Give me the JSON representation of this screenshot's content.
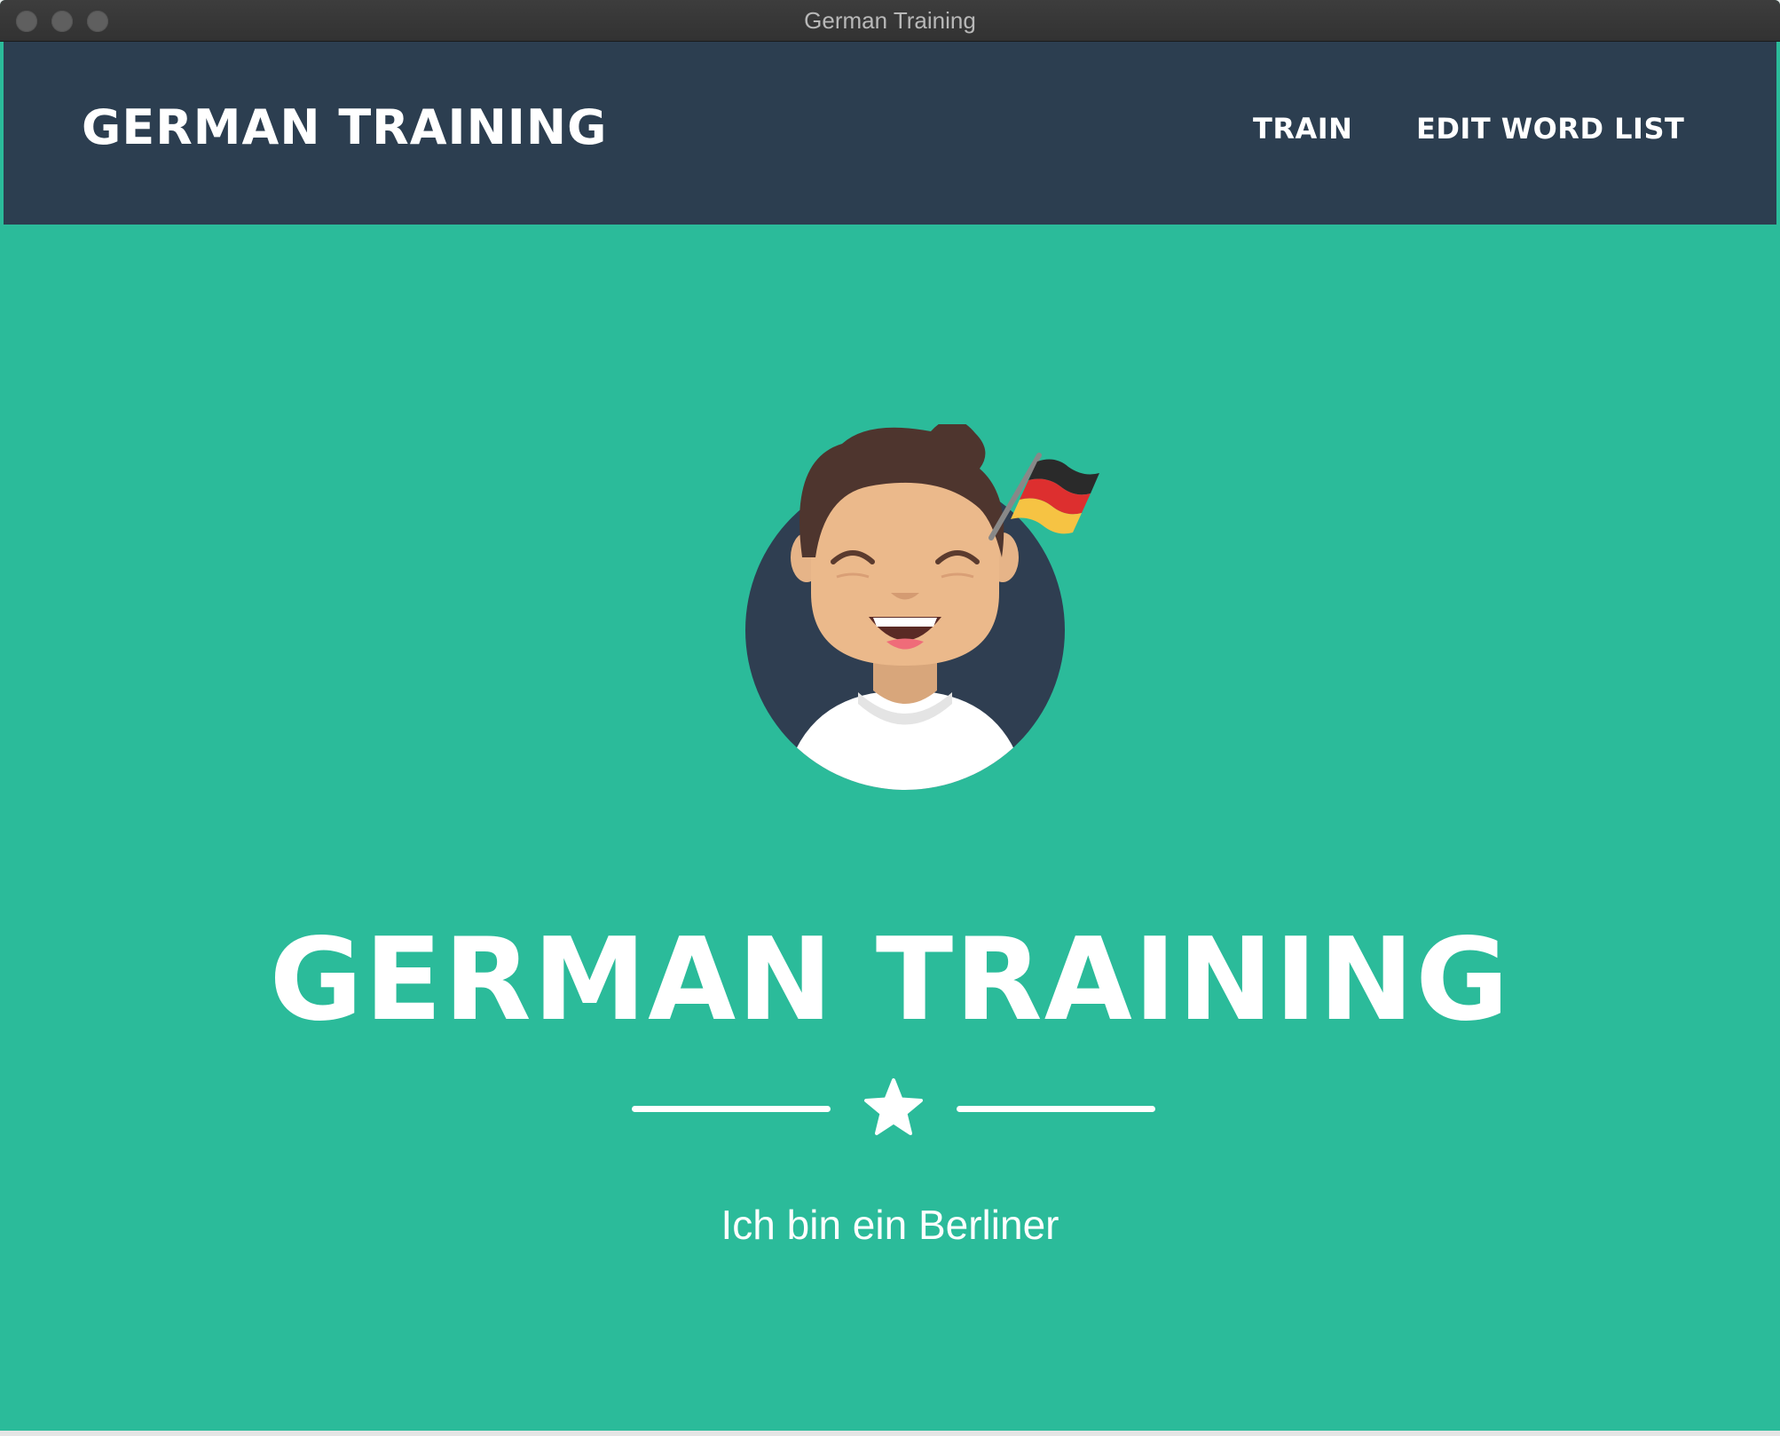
{
  "window": {
    "title": "German Training"
  },
  "navbar": {
    "brand": "GERMAN TRAINING",
    "links": [
      {
        "label": "TRAIN"
      },
      {
        "label": "EDIT WORD LIST"
      }
    ]
  },
  "masthead": {
    "avatar_icon": "smiling-man-with-german-flag-icon",
    "title": "GERMAN TRAINING",
    "divider_icon": "star-icon",
    "subtitle": "Ich bin ein Berliner"
  },
  "colors": {
    "navbar": "#2c3e50",
    "masthead": "#2bbb9a",
    "text": "#ffffff"
  }
}
